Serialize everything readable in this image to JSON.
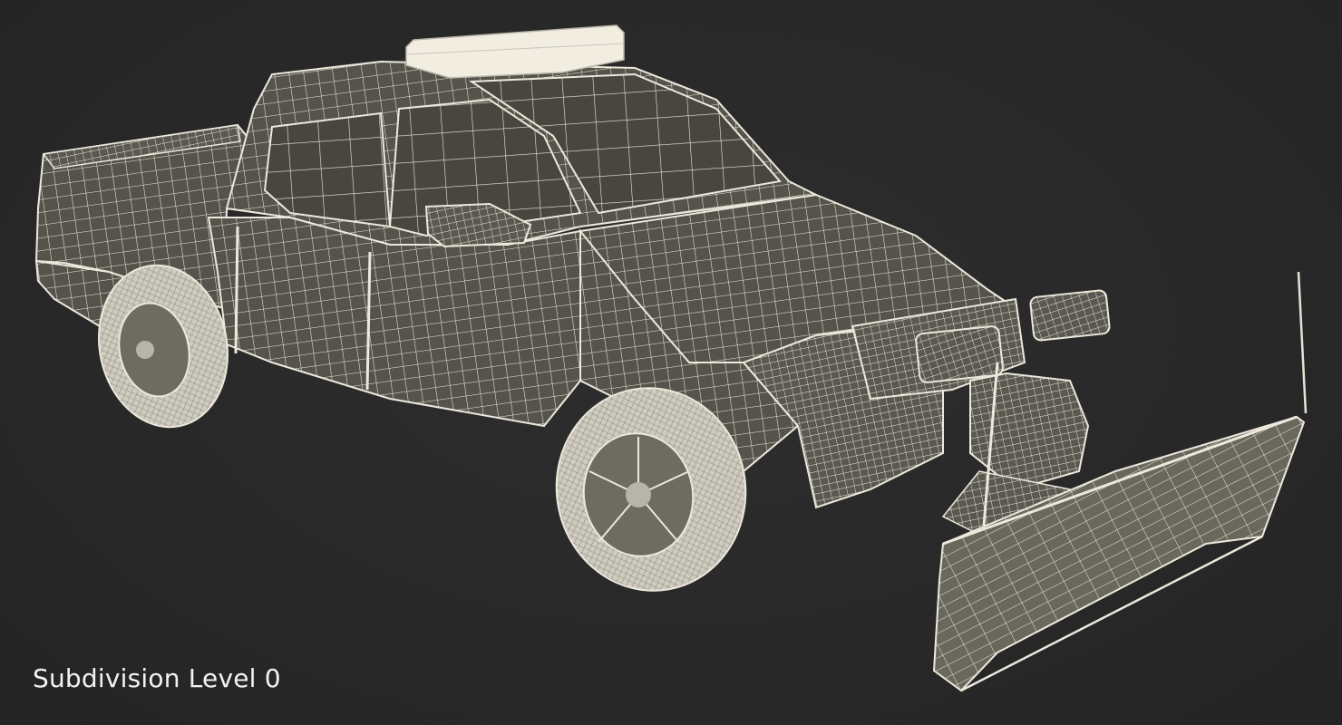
{
  "viewport": {
    "caption": "Subdivision Level 0",
    "background_color": "#2a2a2a",
    "model_fill_color": "#4f4d45",
    "wire_color": "#ece8dc"
  }
}
